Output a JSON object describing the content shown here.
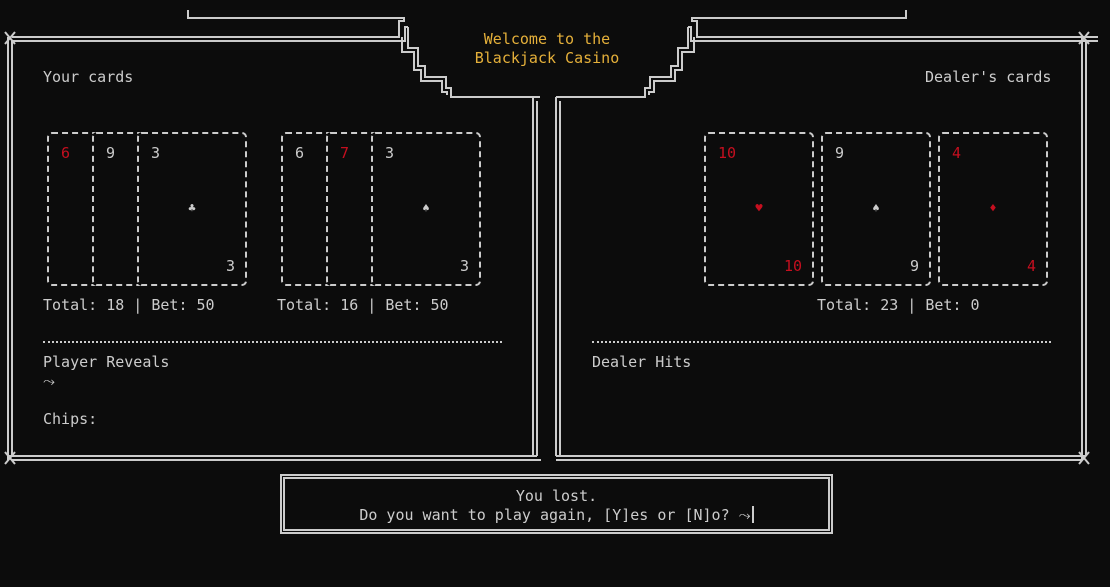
{
  "title": {
    "line1": "Welcome to the",
    "line2": "Blackjack Casino"
  },
  "player": {
    "heading": "Your cards",
    "hands": [
      {
        "cards": [
          {
            "rank": "6",
            "color": "red"
          },
          {
            "rank": "9",
            "color": "white"
          },
          {
            "rank": "3",
            "suit": "♣",
            "color": "white"
          }
        ],
        "total_label": "Total: 18 | Bet: 50"
      },
      {
        "cards": [
          {
            "rank": "6",
            "color": "white"
          },
          {
            "rank": "7",
            "color": "red"
          },
          {
            "rank": "3",
            "suit": "♠",
            "color": "white"
          }
        ],
        "total_label": "Total: 16 | Bet: 50"
      }
    ],
    "action": "Player Reveals",
    "prompt_arrow": "⤳",
    "chips_label": "Chips:"
  },
  "dealer": {
    "heading": "Dealer's cards",
    "cards": [
      {
        "rank": "10",
        "suit": "♥",
        "color": "red"
      },
      {
        "rank": "9",
        "suit": "♠",
        "color": "white"
      },
      {
        "rank": "4",
        "suit": "♦",
        "color": "red"
      }
    ],
    "total_label": "Total: 23 | Bet: 0",
    "action": "Dealer Hits"
  },
  "message": {
    "line1": "You lost.",
    "line2": "Do you want to play again, [Y]es or [N]o? ⤳"
  },
  "colors": {
    "background": "#0c0c0c",
    "text": "#cccccc",
    "title": "#e5b03a",
    "red_card": "#c50f1f"
  }
}
